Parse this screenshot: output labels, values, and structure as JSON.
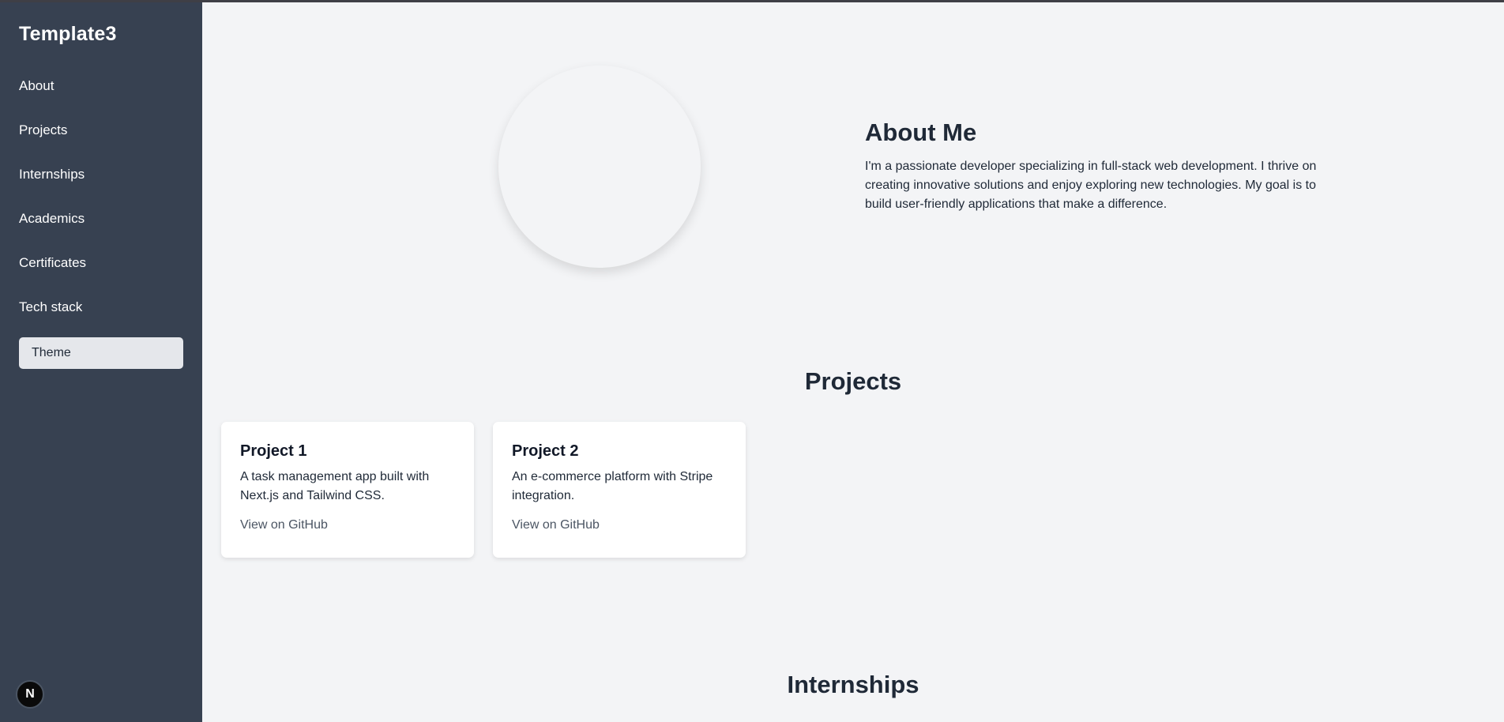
{
  "sidebar": {
    "brand": "Template3",
    "items": [
      {
        "label": "About"
      },
      {
        "label": "Projects"
      },
      {
        "label": "Internships"
      },
      {
        "label": "Academics"
      },
      {
        "label": "Certificates"
      },
      {
        "label": "Tech stack"
      }
    ],
    "theme_label": "Theme",
    "badge_letter": "N"
  },
  "about": {
    "title": "About Me",
    "text": "I'm a passionate developer specializing in full-stack web development. I thrive on creating innovative solutions and enjoy exploring new technologies. My goal is to build user-friendly applications that make a difference."
  },
  "projects": {
    "title": "Projects",
    "items": [
      {
        "title": "Project 1",
        "description": "A task management app built with Next.js and Tailwind CSS.",
        "link": "View on GitHub"
      },
      {
        "title": "Project 2",
        "description": "An e-commerce platform with Stripe integration.",
        "link": "View on GitHub"
      }
    ]
  },
  "internships": {
    "title": "Internships"
  },
  "colors": {
    "sidebar_bg": "#374151",
    "main_bg": "#f3f4f6",
    "card_bg": "#ffffff",
    "text_dark": "#1f2937",
    "link_gray": "#4b5563"
  }
}
